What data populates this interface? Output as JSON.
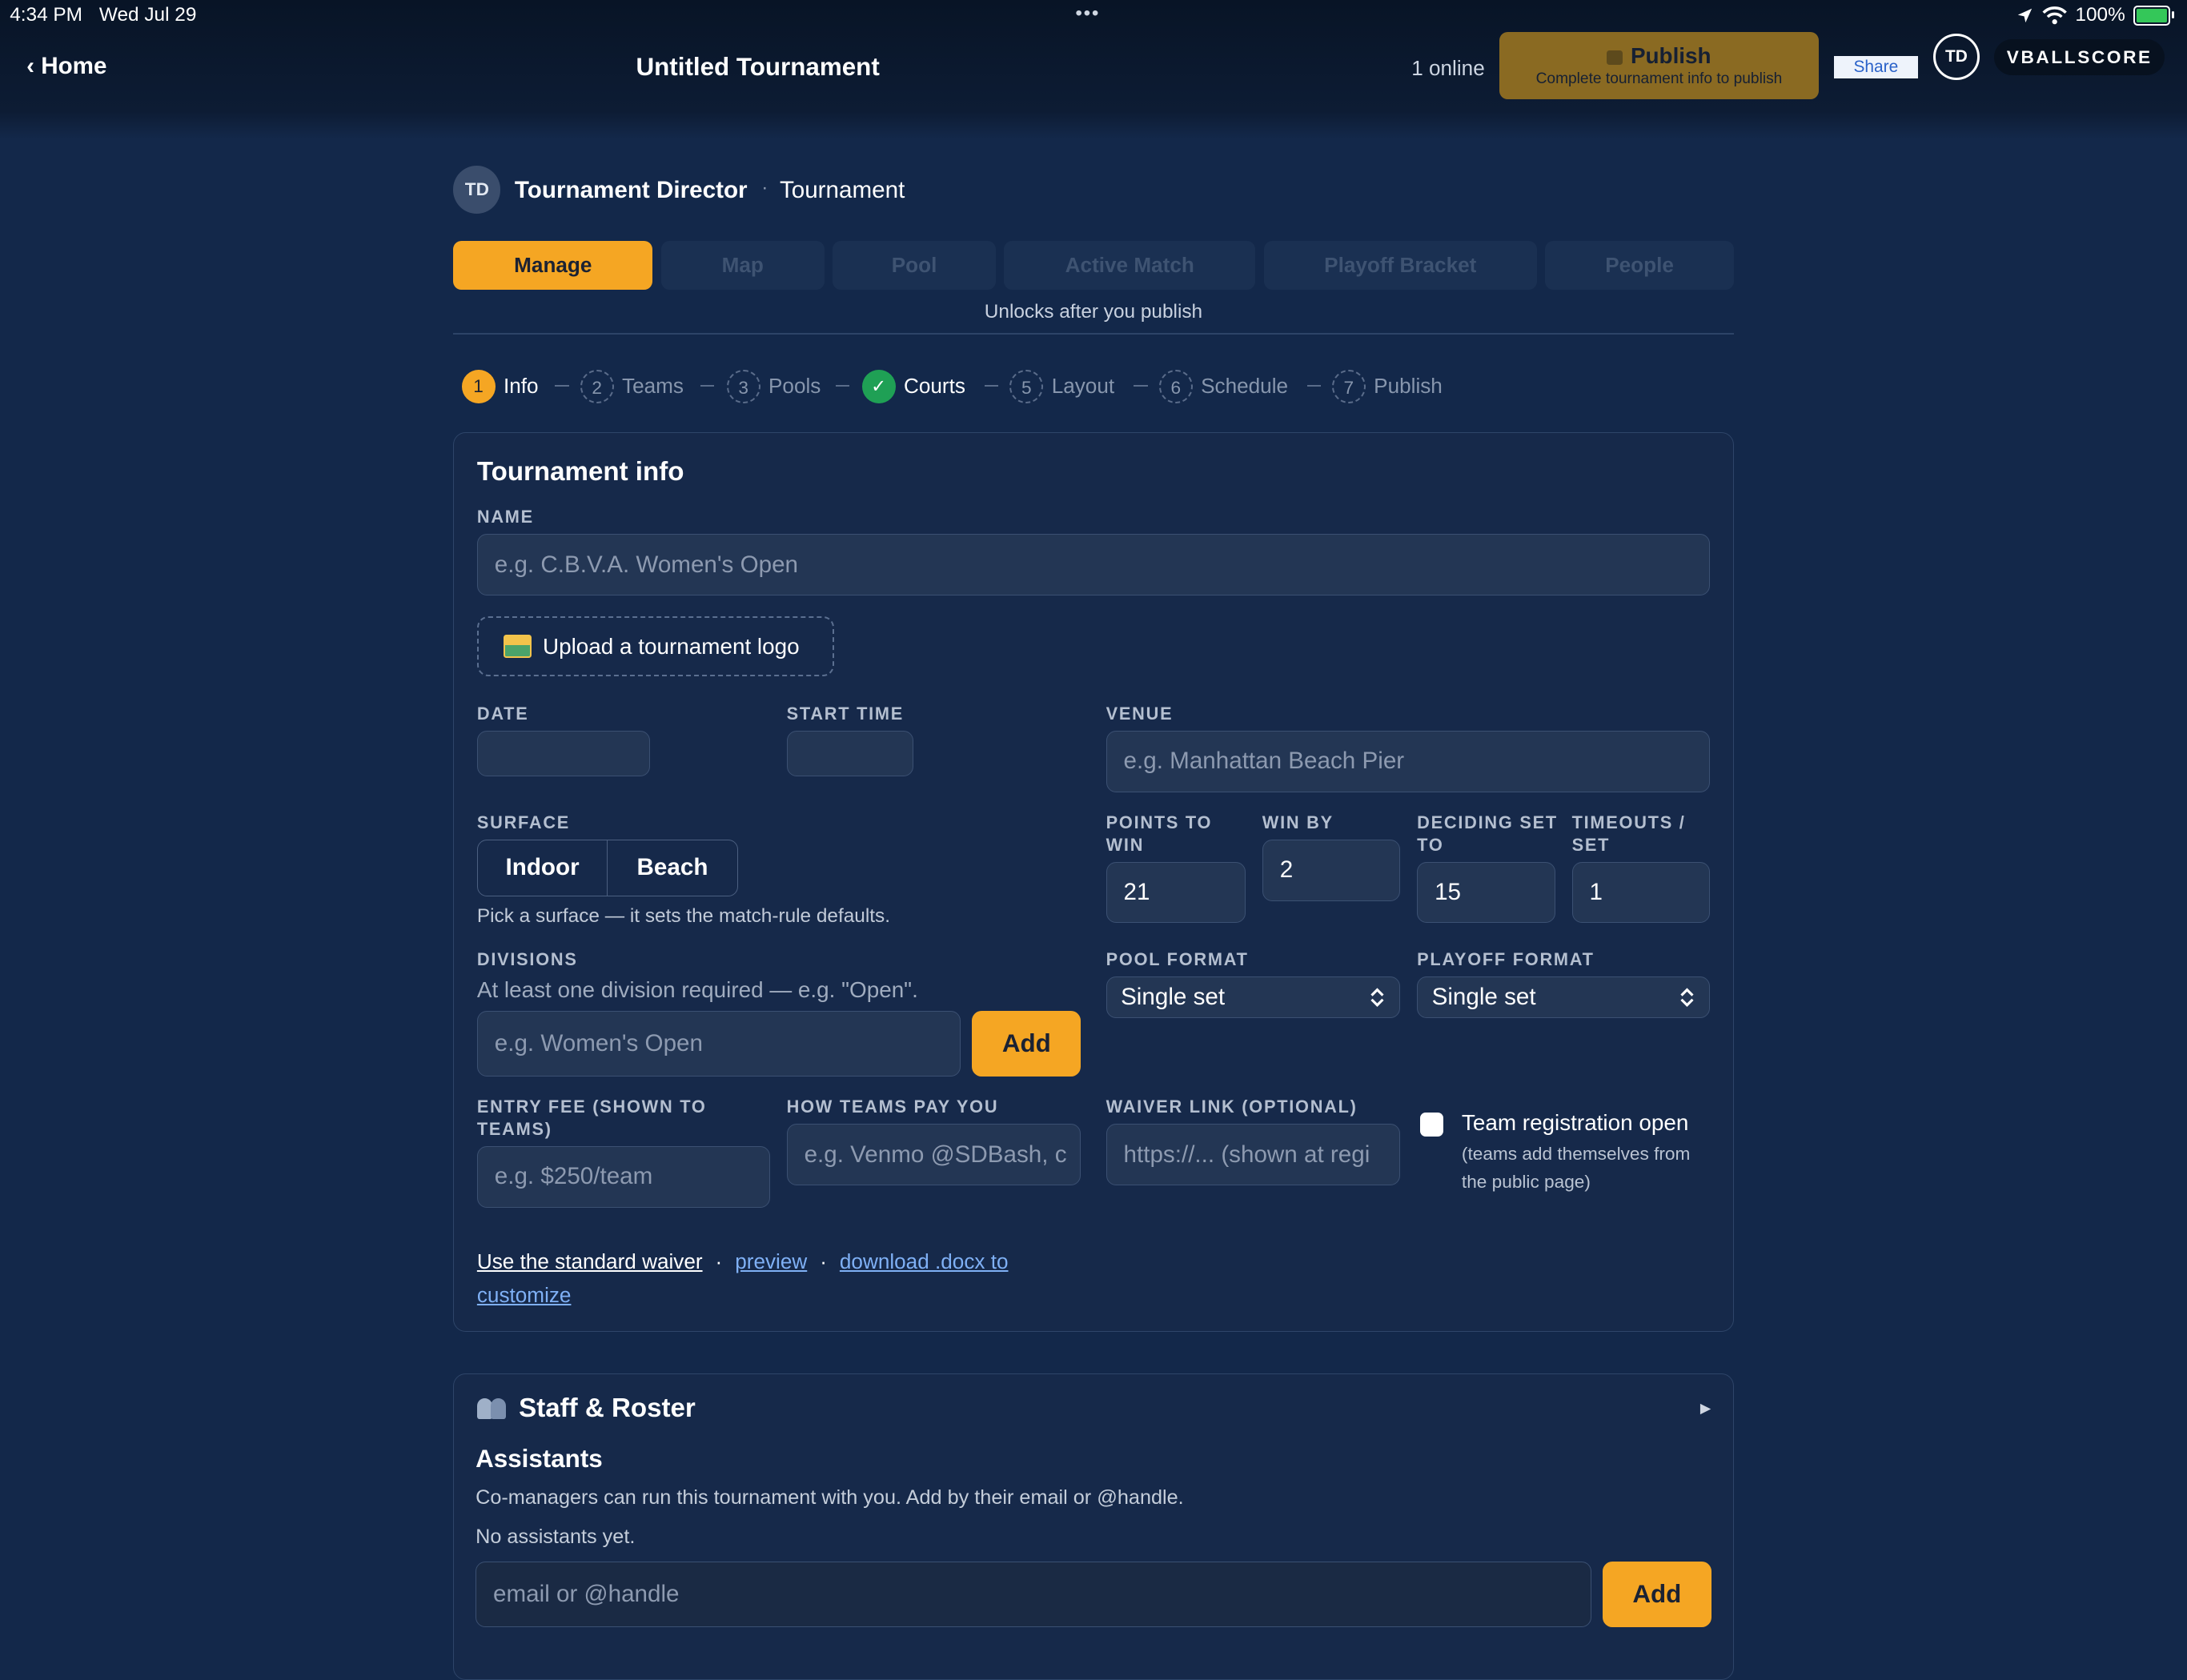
{
  "status": {
    "time": "4:34 PM",
    "date": "Wed Jul 29",
    "battery": "100%",
    "dots": "•••"
  },
  "topbar": {
    "home_label": "Home",
    "title": "Untitled Tournament",
    "online": "1 online",
    "publish_label": "Publish",
    "publish_sub": "Complete tournament info to publish",
    "share_label": "Share",
    "avatar": "TD",
    "brand": "VBALLSCORE"
  },
  "header": {
    "avatar": "TD",
    "name": "Tournament Director",
    "separator": "·",
    "role": "Tournament"
  },
  "tabs": [
    {
      "label": "Manage"
    },
    {
      "label": "Map"
    },
    {
      "label": "Pool"
    },
    {
      "label": "Active Match"
    },
    {
      "label": "Playoff Bracket"
    },
    {
      "label": "People"
    }
  ],
  "unlocks_note": "Unlocks after you publish",
  "steps": [
    {
      "num": "1",
      "label": "Info"
    },
    {
      "num": "2",
      "label": "Teams"
    },
    {
      "num": "3",
      "label": "Pools"
    },
    {
      "num": "✓",
      "label": "Courts"
    },
    {
      "num": "5",
      "label": "Layout"
    },
    {
      "num": "6",
      "label": "Schedule"
    },
    {
      "num": "7",
      "label": "Publish"
    }
  ],
  "info": {
    "title": "Tournament info",
    "name_label": "NAME",
    "name_placeholder": "e.g. C.B.V.A. Women's Open",
    "upload_label": "Upload a tournament logo",
    "date_label": "DATE",
    "start_label": "START TIME",
    "venue_label": "VENUE",
    "venue_placeholder": "e.g. Manhattan Beach Pier",
    "surface_label": "SURFACE",
    "surface_options": [
      "Indoor",
      "Beach"
    ],
    "surface_hint": "Pick a surface — it sets the match-rule defaults.",
    "points_label": "POINTS TO WIN",
    "points_value": "21",
    "winby_label": "WIN BY",
    "winby_value": "2",
    "deciding_label": "DECIDING SET TO",
    "deciding_value": "15",
    "timeouts_label": "TIMEOUTS / SET",
    "timeouts_value": "1",
    "divisions_label": "DIVISIONS",
    "divisions_hint": "At least one division required — e.g. \"Open\".",
    "division_placeholder": "e.g. Women's Open",
    "add_label": "Add",
    "pool_format_label": "POOL FORMAT",
    "pool_format_value": "Single set",
    "playoff_format_label": "PLAYOFF FORMAT",
    "playoff_format_value": "Single set",
    "entry_fee_label": "ENTRY FEE (SHOWN TO TEAMS)",
    "entry_fee_placeholder": "e.g. $250/team",
    "pay_label": "HOW TEAMS PAY YOU",
    "pay_placeholder": "e.g. Venmo @SDBash, c",
    "waiver_label": "WAIVER LINK (OPTIONAL)",
    "waiver_placeholder": "https://... (shown at regi",
    "registration_label": "Team registration open",
    "registration_sub": "(teams add themselves from the public page)",
    "link_standard": "Use the standard waiver",
    "link_preview": "preview",
    "link_download": "download .docx to customize",
    "link_sep": "·"
  },
  "staff": {
    "title": "Staff & Roster",
    "assistants_title": "Assistants",
    "assistants_desc": "Co-managers can run this tournament with you. Add by their email or @handle.",
    "assistants_none": "No assistants yet.",
    "email_placeholder": "email or @handle",
    "add_label": "Add"
  }
}
